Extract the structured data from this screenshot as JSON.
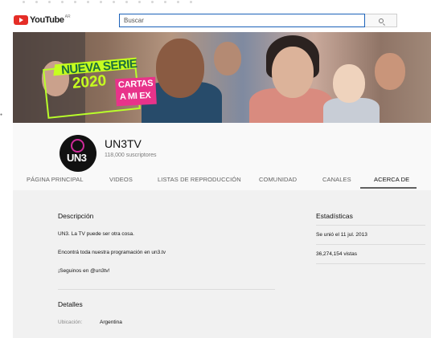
{
  "masthead": {
    "logo_text": "YouTube",
    "logo_region": "AR",
    "search_placeholder": "Buscar"
  },
  "banner": {
    "line1": "NUEVA SERIE",
    "line2": "2020",
    "pink_line1": "CARTAS",
    "pink_line2": "A MI EX"
  },
  "channel": {
    "avatar_label": "UN3",
    "name": "UN3TV",
    "subscribers": "118,000 suscriptores"
  },
  "tabs": [
    {
      "label": "PÁGINA PRINCIPAL"
    },
    {
      "label": "VIDEOS"
    },
    {
      "label": "LISTAS DE REPRODUCCIÓN"
    },
    {
      "label": "COMUNIDAD"
    },
    {
      "label": "CANALES"
    },
    {
      "label": "ACERCA DE"
    }
  ],
  "about": {
    "description_title": "Descripción",
    "description_lines": [
      "UN3. La TV puede ser otra cosa.",
      "Encontrá toda nuestra programación en un3.tv",
      "¡Seguinos en @un3tv!"
    ],
    "details_title": "Detalles",
    "location_label": "Ubicación:",
    "location_value": "Argentina"
  },
  "stats": {
    "title": "Estadísticas",
    "joined": "Se unió el 11 jul. 2013",
    "views": "36,274,154 vistas"
  },
  "colors": {
    "brand_red": "#e52d27",
    "search_border": "#1c62b9",
    "neon_green": "#c6ff1f",
    "pink": "#e8338a"
  }
}
